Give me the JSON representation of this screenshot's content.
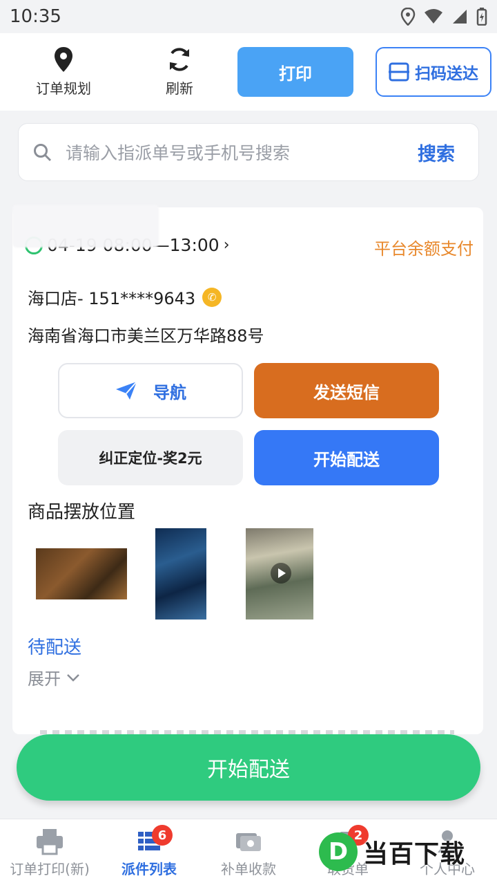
{
  "status_bar": {
    "time": "10:35"
  },
  "toolbar": {
    "order_plan_label": "订单规划",
    "refresh_label": "刷新",
    "print_label": "打印",
    "scan_deliver_label": "扫码送达"
  },
  "search": {
    "placeholder": "请输入指派单号或手机号搜索",
    "button_label": "搜索"
  },
  "order": {
    "time_window": "04-19  08:00—13:00",
    "payment": "平台余额支付",
    "contact": "海口店- 151****9643",
    "address": "海南省海口市美兰区万华路88号",
    "nav_label": "导航",
    "sms_label": "发送短信",
    "fix_location_label": "纠正定位-奖2元",
    "start_label": "开始配送",
    "placement_title": "商品摆放位置",
    "status": "待配送",
    "expand_label": "展开"
  },
  "bottom_action": {
    "label": "开始配送"
  },
  "tabbar": {
    "items": [
      {
        "label": "订单打印(新)"
      },
      {
        "label": "派件列表",
        "badge": "6"
      },
      {
        "label": "补单收款"
      },
      {
        "label": "取货单",
        "badge": "2"
      },
      {
        "label": "个人中心"
      }
    ]
  },
  "watermark": {
    "logo": "D",
    "text": "当百下载"
  },
  "colors": {
    "accent": "#2f6fe0",
    "green": "#2fcb7f",
    "orange": "#d86d1f",
    "pay": "#e8882c"
  }
}
